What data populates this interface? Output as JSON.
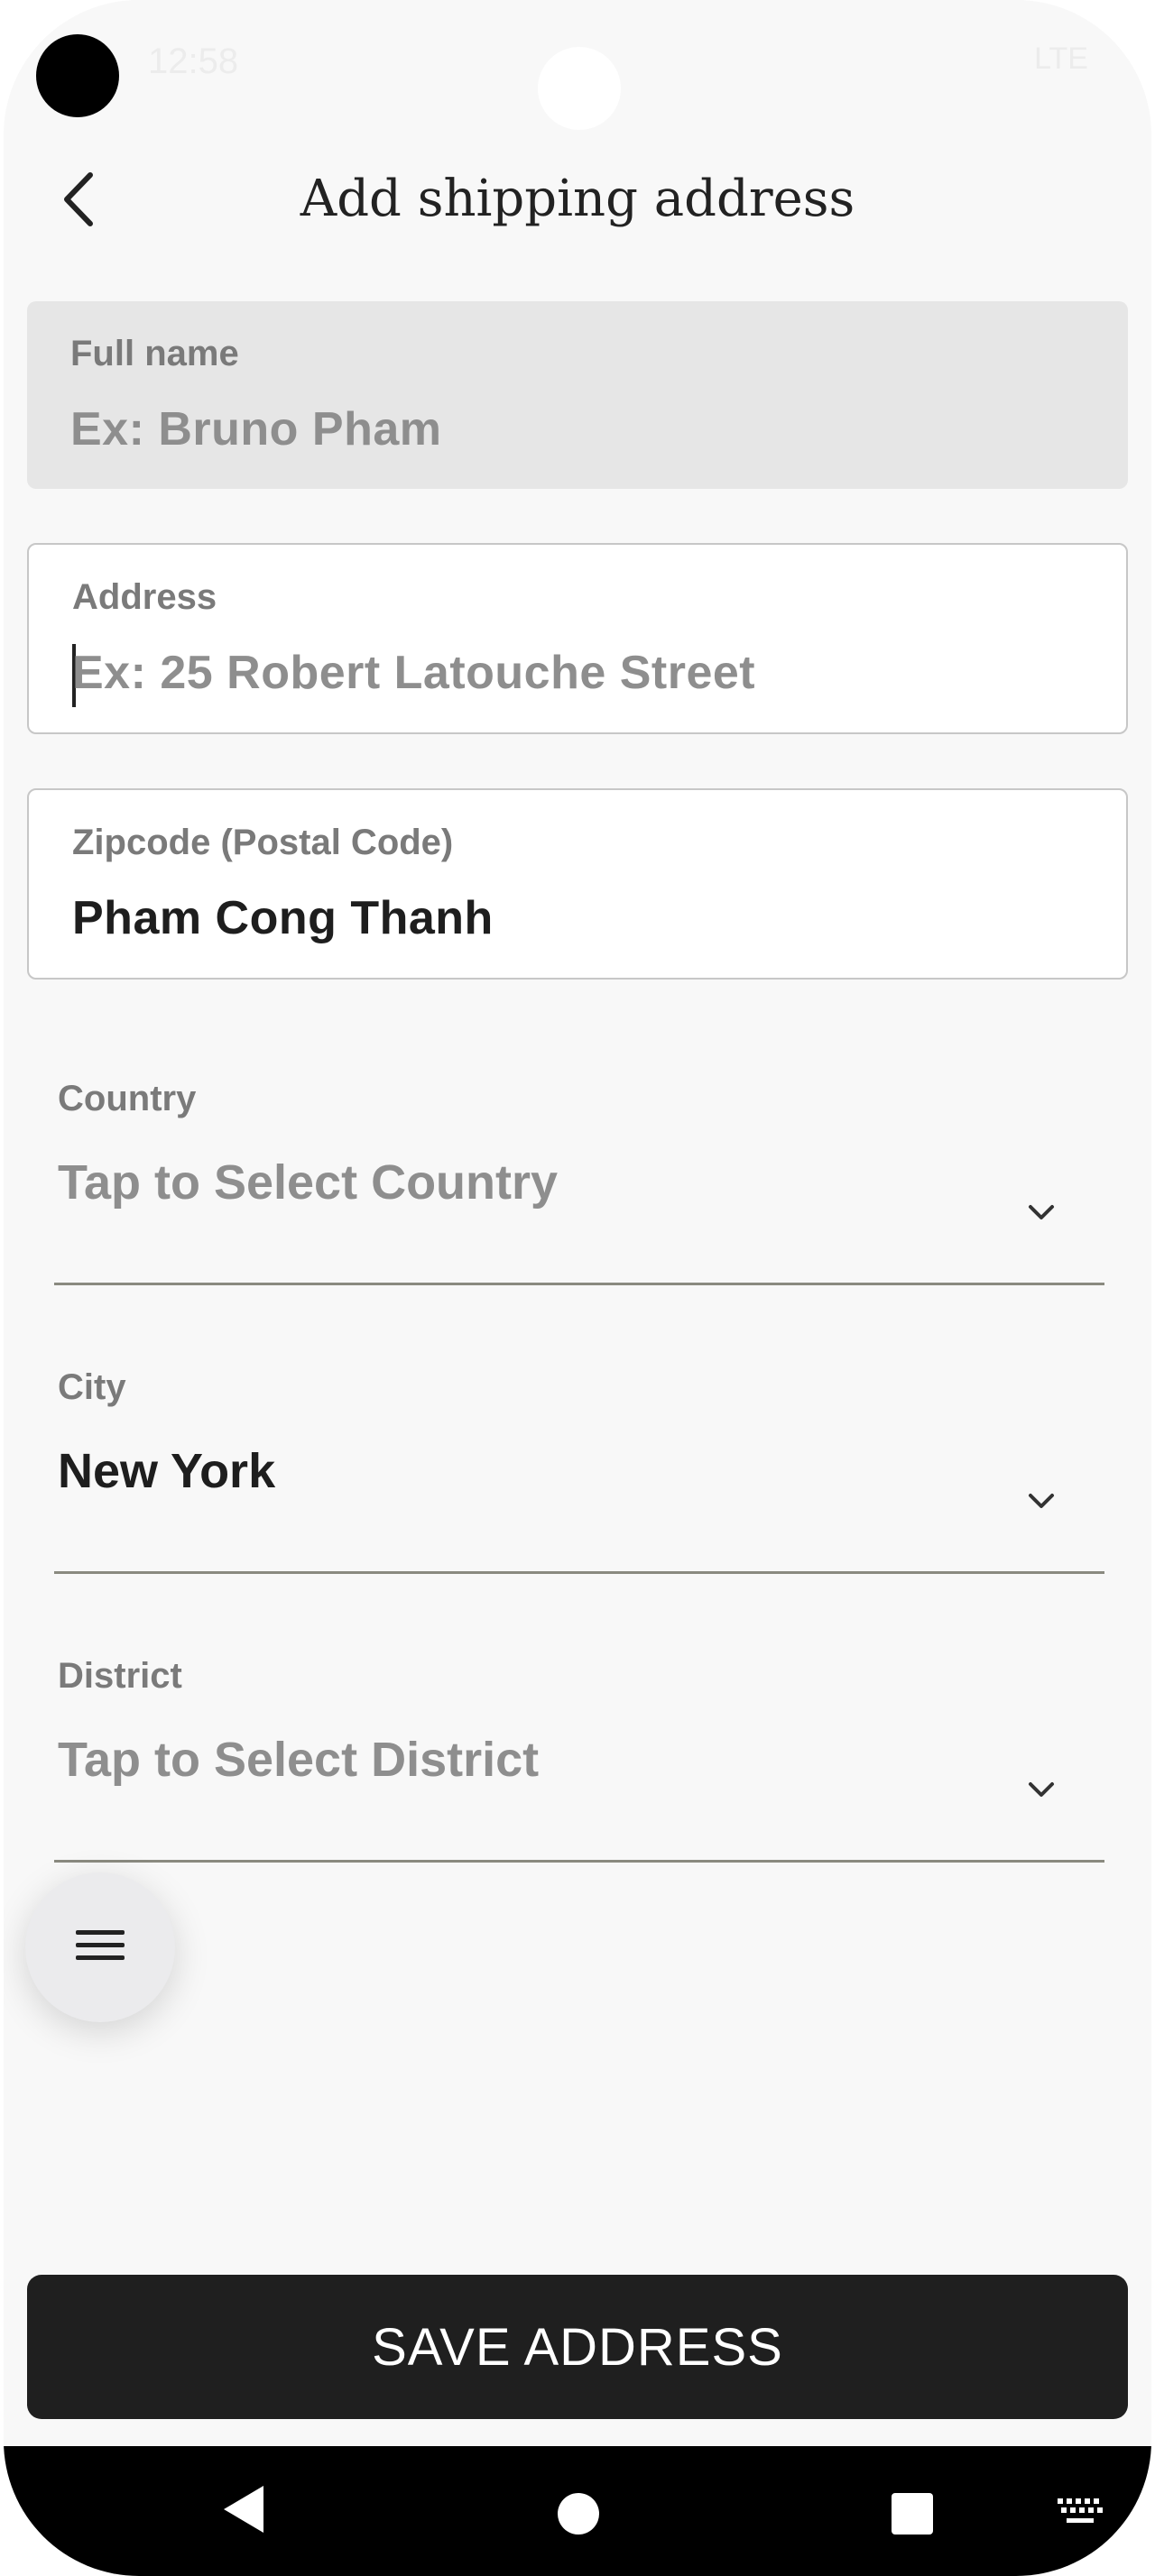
{
  "status_bar": {
    "time": "12:58",
    "network": "LTE"
  },
  "header": {
    "title": "Add shipping address",
    "back_icon": "chevron-left-icon"
  },
  "form": {
    "full_name": {
      "label": "Full name",
      "placeholder": "Ex: Bruno Pham"
    },
    "address": {
      "label": "Address",
      "placeholder": "Ex: 25 Robert Latouche Street"
    },
    "zipcode": {
      "label": "Zipcode (Postal Code)",
      "value": "Pham Cong Thanh"
    },
    "country": {
      "label": "Country",
      "placeholder": "Tap to Select Country"
    },
    "city": {
      "label": "City",
      "value": "New York"
    },
    "district": {
      "label": "District",
      "placeholder": "Tap to Select District"
    }
  },
  "fab": {
    "icon": "menu-icon"
  },
  "save_button": {
    "label": "SAVE ADDRESS"
  },
  "nav": {
    "back_icon": "nav-back-icon",
    "home_icon": "nav-home-icon",
    "recents_icon": "nav-recents-icon",
    "keyboard_icon": "keyboard-icon"
  }
}
